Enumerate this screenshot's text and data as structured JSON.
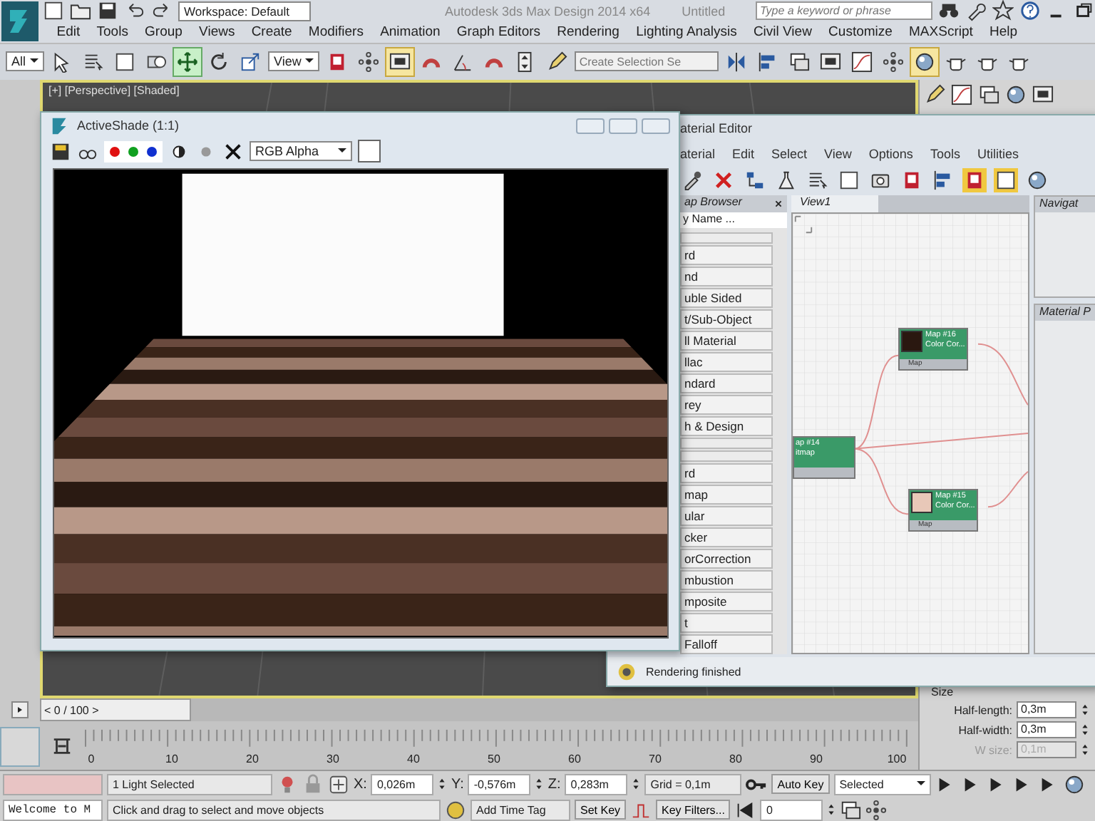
{
  "title_bar": {
    "workspace": "Workspace: Default",
    "title": "Autodesk 3ds Max Design 2014 x64",
    "document": "Untitled",
    "search": {
      "placeholder": "Type a keyword or phrase"
    }
  },
  "menu_bar": [
    "Edit",
    "Tools",
    "Group",
    "Views",
    "Create",
    "Modifiers",
    "Animation",
    "Graph Editors",
    "Rendering",
    "Lighting Analysis",
    "Civil View",
    "Customize",
    "MAXScript",
    "Help"
  ],
  "main_toolbar": [
    {
      "kind": "dropdown",
      "value": "All"
    },
    {
      "kind": "cursor",
      "selected": false
    },
    {
      "kind": "list",
      "selected": false
    },
    {
      "kind": "square",
      "selected": false
    },
    {
      "kind": "window",
      "selected": false
    },
    {
      "kind": "move",
      "selected": true
    },
    {
      "kind": "rotate",
      "selected": false
    },
    {
      "kind": "scale",
      "selected": false
    },
    {
      "kind": "dropdown",
      "value": "View"
    },
    {
      "kind": "pivot",
      "selected": false
    },
    {
      "kind": "nodes",
      "selected": false
    },
    {
      "kind": "monitor",
      "selected": true
    },
    {
      "kind": "magnet",
      "selected": false
    },
    {
      "kind": "angle",
      "selected": false
    },
    {
      "kind": "magnet",
      "selected": false
    },
    {
      "kind": "spinner",
      "selected": false
    },
    {
      "kind": "pencil",
      "selected": false
    },
    {
      "kind": "field",
      "placeholder": "Create Selection Se"
    },
    {
      "kind": "mirror",
      "selected": false
    },
    {
      "kind": "align",
      "selected": false
    },
    {
      "kind": "layers",
      "selected": false
    },
    {
      "kind": "monitor",
      "selected": false
    },
    {
      "kind": "curve",
      "selected": false
    },
    {
      "kind": "nodes",
      "selected": false
    },
    {
      "kind": "sphere",
      "selected": true
    },
    {
      "kind": "teapot",
      "selected": false
    },
    {
      "kind": "teapot",
      "selected": false
    },
    {
      "kind": "teapot",
      "selected": false
    }
  ],
  "viewport": {
    "label": "[+] [Perspective] [Shaded]"
  },
  "activeshade": {
    "title": "ActiveShade (1:1)",
    "channels": [
      {
        "color": "#e01010",
        "on": true
      },
      {
        "color": "#10a020",
        "on": true
      },
      {
        "color": "#1030d0",
        "on": true
      }
    ],
    "display": "RGB Alpha"
  },
  "material_editor": {
    "title": "aterial Editor",
    "menu": [
      "aterial",
      "Edit",
      "Select",
      "View",
      "Options",
      "Tools",
      "Utilities"
    ],
    "toolbar": [
      {
        "kind": "pick",
        "selected": false
      },
      {
        "kind": "delete",
        "selected": false
      },
      {
        "kind": "move-children",
        "selected": false
      },
      {
        "kind": "assign",
        "selected": false
      },
      {
        "kind": "list",
        "selected": false
      },
      {
        "kind": "square",
        "selected": false
      },
      {
        "kind": "camera",
        "selected": false
      },
      {
        "kind": "pivot",
        "selected": false
      },
      {
        "kind": "align",
        "selected": false
      },
      {
        "kind": "pivot",
        "selected": true
      },
      {
        "kind": "square",
        "selected": true
      },
      {
        "kind": "sphere",
        "selected": false
      }
    ],
    "browser": {
      "title": "ap Browser",
      "search": "y Name ...",
      "items": [
        {
          "kind": "blank"
        },
        {
          "kind": "item",
          "label": "rd"
        },
        {
          "kind": "item",
          "label": "nd"
        },
        {
          "kind": "item",
          "label": "uble Sided"
        },
        {
          "kind": "item",
          "label": "t/Sub-Object"
        },
        {
          "kind": "item",
          "label": "ll Material"
        },
        {
          "kind": "item",
          "label": "llac"
        },
        {
          "kind": "item",
          "label": "ndard"
        },
        {
          "kind": "item",
          "label": "rey"
        },
        {
          "kind": "item",
          "label": "h & Design"
        },
        {
          "kind": "blank"
        },
        {
          "kind": "blank"
        },
        {
          "kind": "item",
          "label": "rd"
        },
        {
          "kind": "item",
          "label": "map"
        },
        {
          "kind": "item",
          "label": "ular"
        },
        {
          "kind": "item",
          "label": "cker"
        },
        {
          "kind": "item",
          "label": "orCorrection"
        },
        {
          "kind": "item",
          "label": "mbustion"
        },
        {
          "kind": "item",
          "label": "mposite"
        },
        {
          "kind": "item",
          "label": "t"
        },
        {
          "kind": "item",
          "label": "Falloff"
        }
      ]
    },
    "view_tab": "View1",
    "nodes": [
      {
        "title": "Map #16",
        "subtitle": "Color Cor...",
        "port": "Map",
        "color": "#2a1810"
      },
      {
        "title": "ap #14",
        "subtitle": "itmap"
      },
      {
        "title": "Map #15",
        "subtitle": "Color Cor...",
        "port": "Map",
        "color": "#e8c8b8"
      }
    ],
    "navigator": "Navigat",
    "params": "Material P",
    "status": "Rendering finished"
  },
  "command_panel": {
    "section": "Size",
    "fields": [
      {
        "label": "Half-length:",
        "value": "0,3m",
        "disabled": false
      },
      {
        "label": "Half-width:",
        "value": "0,3m",
        "disabled": false
      },
      {
        "label": "W size:",
        "value": "0,1m",
        "disabled": true
      }
    ]
  },
  "time_slider": {
    "prev": "<",
    "label": "0 / 100",
    "next": ">",
    "ticks": [
      "0",
      "10",
      "20",
      "30",
      "40",
      "50",
      "60",
      "70",
      "80",
      "90",
      "100"
    ]
  },
  "status_bar": {
    "listener": "Welcome to M",
    "selection": "1 Light Selected",
    "coordinates": [
      {
        "axis": "X:",
        "value": "0,026m"
      },
      {
        "axis": "Y:",
        "value": "-0,576m"
      },
      {
        "axis": "Z:",
        "value": "0,283m"
      }
    ],
    "grid": "Grid = 0,1m",
    "prompt": "Click and drag to select and move objects",
    "time_tag": "Add Time Tag",
    "auto_key": "Auto Key",
    "key_mode": "Selected",
    "set_key": "Set Key",
    "key_filters": "Key Filters...",
    "frame": "0"
  }
}
